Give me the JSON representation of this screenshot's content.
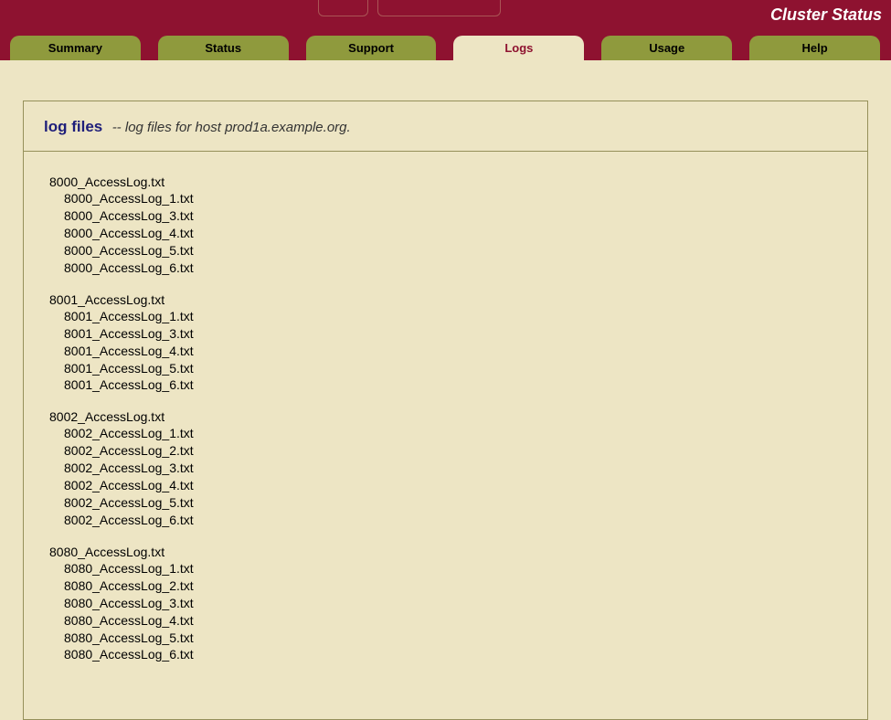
{
  "header": {
    "cluster_status_label": "Cluster Status"
  },
  "tabs": [
    {
      "label": "Summary",
      "active": false
    },
    {
      "label": "Status",
      "active": false
    },
    {
      "label": "Support",
      "active": false
    },
    {
      "label": "Logs",
      "active": true
    },
    {
      "label": "Usage",
      "active": false
    },
    {
      "label": "Help",
      "active": false
    }
  ],
  "panel": {
    "title": "log files",
    "separator": " -- ",
    "subtitle": "log files for host prod1a.example.org."
  },
  "log_groups": [
    {
      "parent": "8000_AccessLog.txt",
      "children": [
        "8000_AccessLog_1.txt",
        "8000_AccessLog_3.txt",
        "8000_AccessLog_4.txt",
        "8000_AccessLog_5.txt",
        "8000_AccessLog_6.txt"
      ]
    },
    {
      "parent": "8001_AccessLog.txt",
      "children": [
        "8001_AccessLog_1.txt",
        "8001_AccessLog_3.txt",
        "8001_AccessLog_4.txt",
        "8001_AccessLog_5.txt",
        "8001_AccessLog_6.txt"
      ]
    },
    {
      "parent": "8002_AccessLog.txt",
      "children": [
        "8002_AccessLog_1.txt",
        "8002_AccessLog_2.txt",
        "8002_AccessLog_3.txt",
        "8002_AccessLog_4.txt",
        "8002_AccessLog_5.txt",
        "8002_AccessLog_6.txt"
      ]
    },
    {
      "parent": "8080_AccessLog.txt",
      "children": [
        "8080_AccessLog_1.txt",
        "8080_AccessLog_2.txt",
        "8080_AccessLog_3.txt",
        "8080_AccessLog_4.txt",
        "8080_AccessLog_5.txt",
        "8080_AccessLog_6.txt"
      ]
    }
  ]
}
